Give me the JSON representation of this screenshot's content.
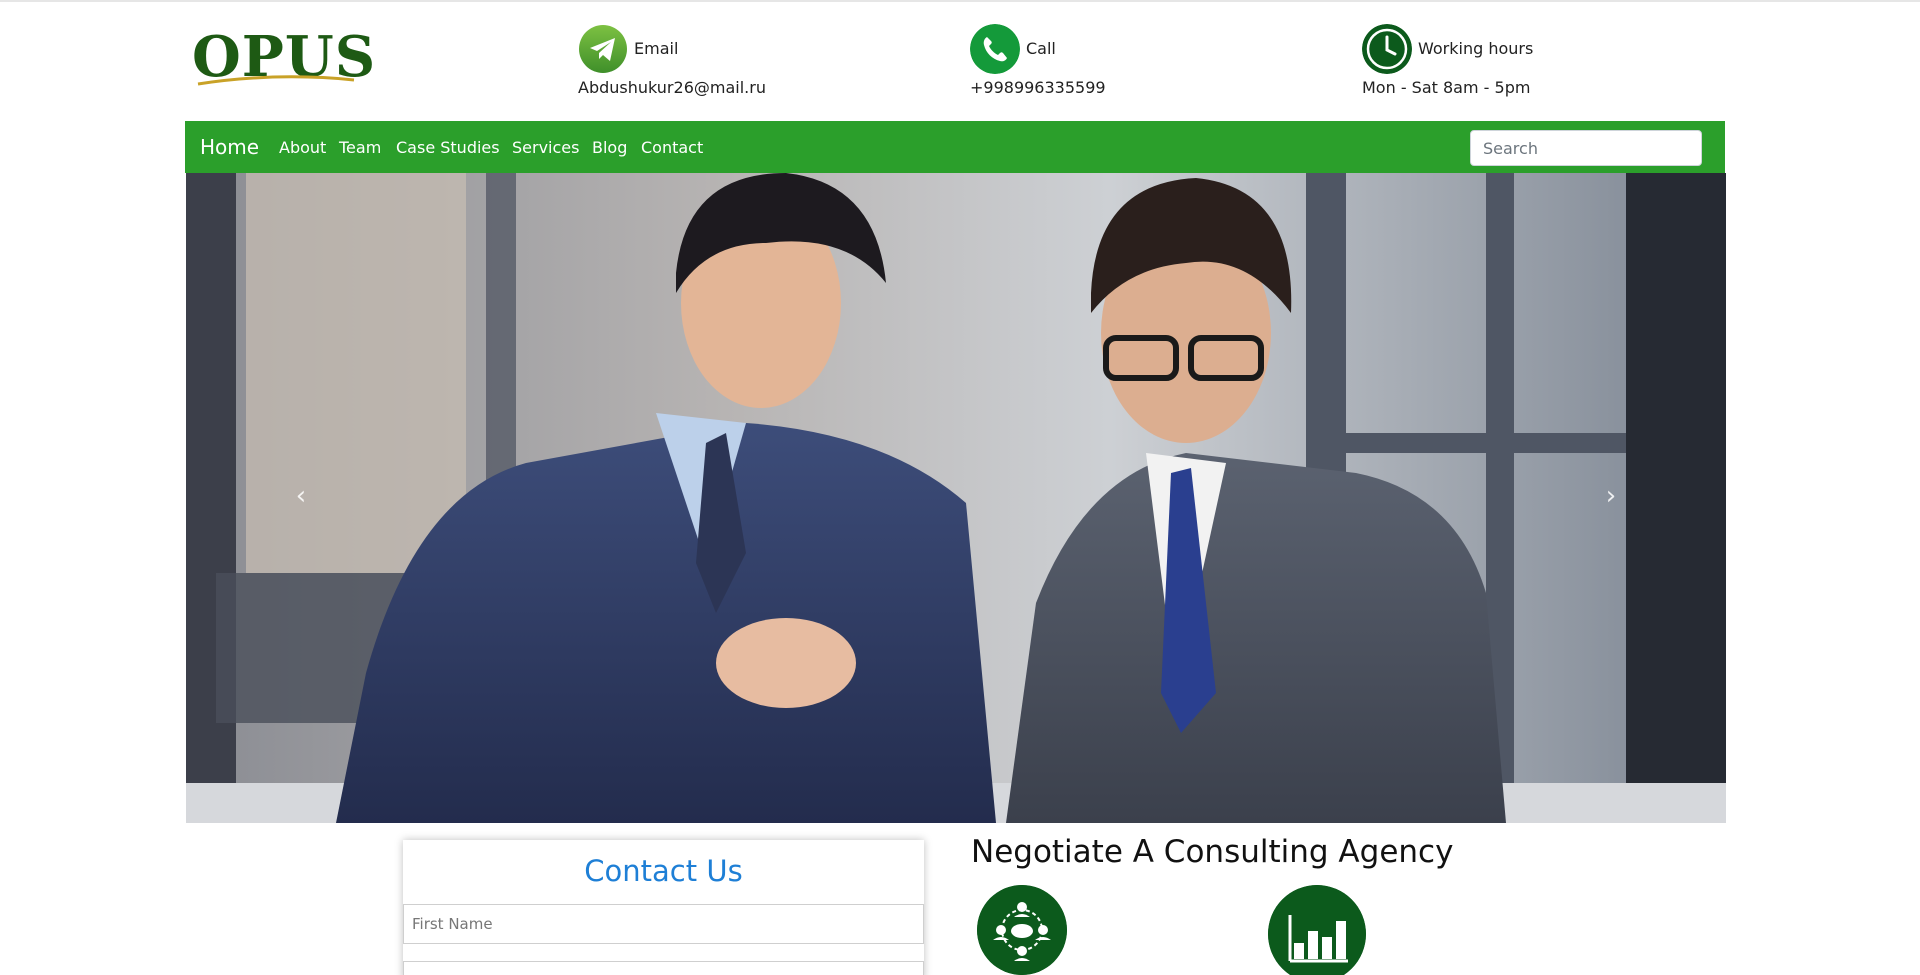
{
  "header": {
    "logo_text": "OPUS",
    "email": {
      "label": "Email",
      "value": "Abdushukur26@mail.ru",
      "icon": "telegram-icon"
    },
    "call": {
      "label": "Call",
      "value": "+998996335599",
      "icon": "phone-icon"
    },
    "hours": {
      "label": "Working hours",
      "value": "Mon - Sat 8am - 5pm",
      "icon": "clock-icon"
    }
  },
  "nav": {
    "brand": "Home",
    "links": [
      "About",
      "Team",
      "Case Studies",
      "Services",
      "Blog",
      "Contact"
    ],
    "search_placeholder": "Search"
  },
  "hero": {
    "prev_icon": "chevron-left-icon",
    "next_icon": "chevron-right-icon"
  },
  "contact": {
    "title": "Contact Us",
    "first_name_placeholder": "First Name"
  },
  "about": {
    "heading": "Negotiate A Consulting Agency",
    "icons": [
      "team-network-icon",
      "bar-chart-icon"
    ]
  },
  "colors": {
    "nav_green": "#2b9f2b",
    "dark_green": "#0c5a1c",
    "contact_title_blue": "#1e7fd6"
  }
}
